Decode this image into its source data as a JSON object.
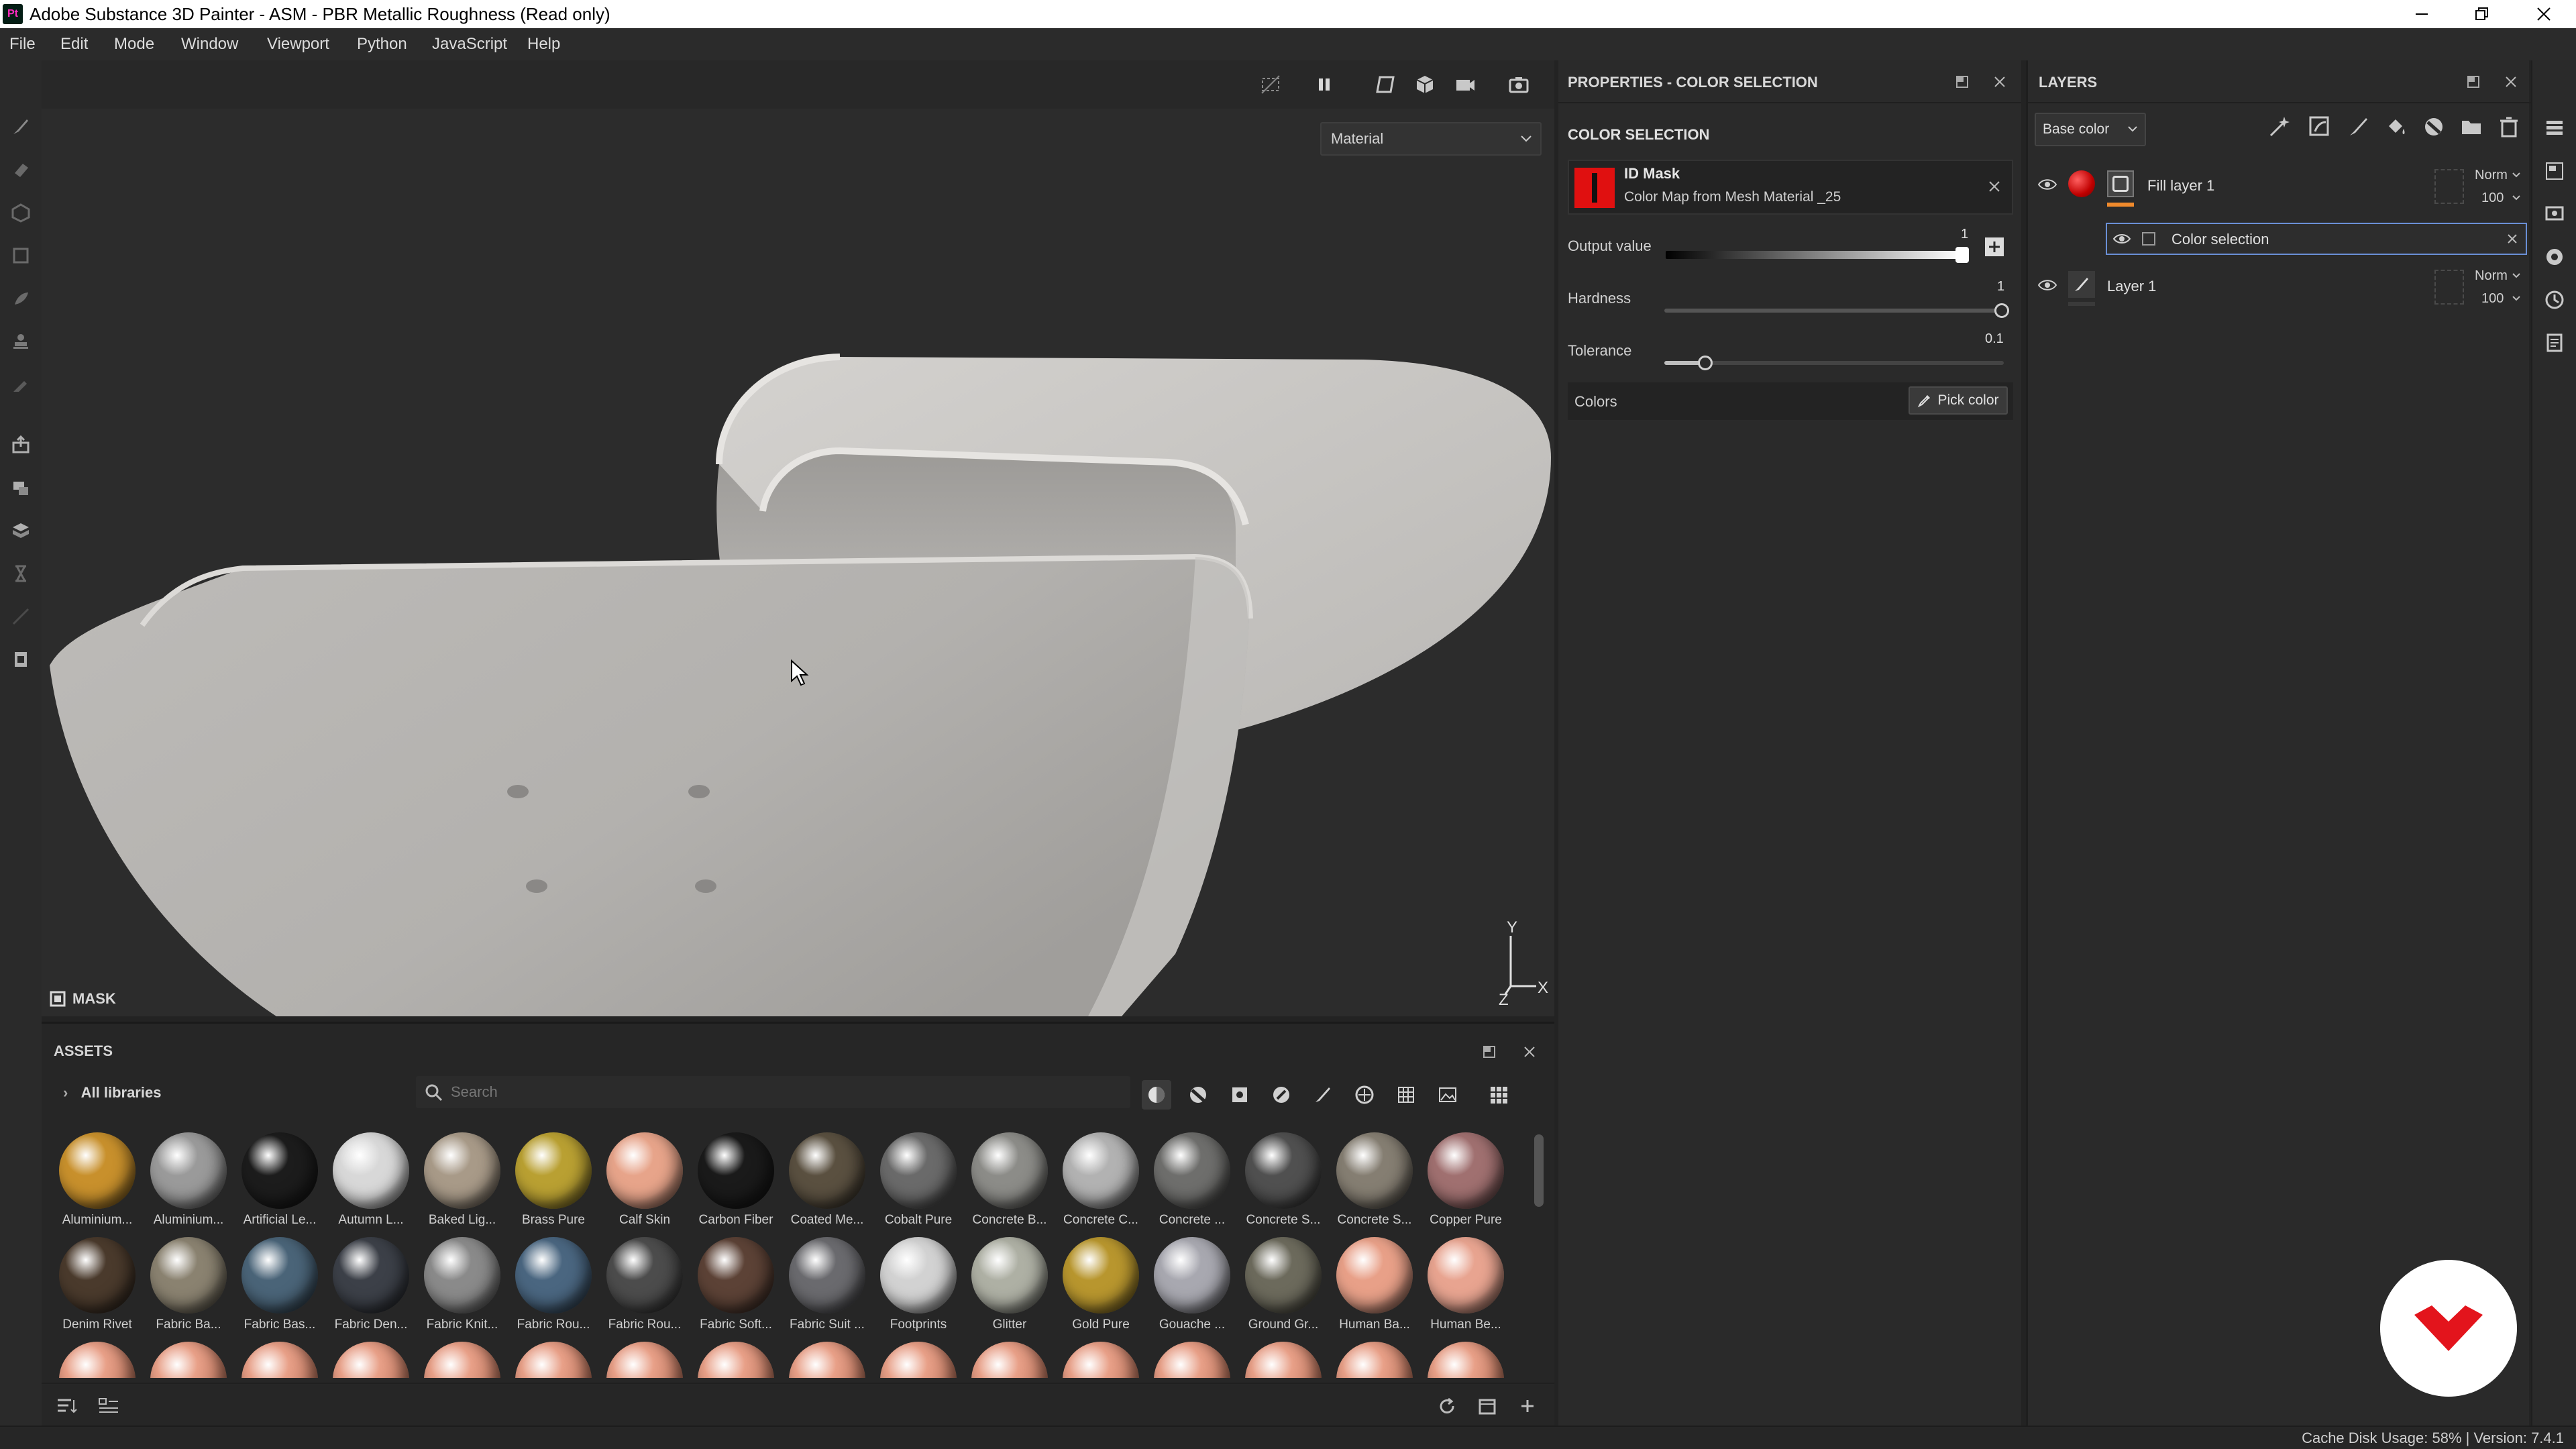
{
  "window": {
    "app_logo": "Pt",
    "title": "Adobe Substance 3D Painter - ASM - PBR Metallic Roughness (Read only)",
    "controls": [
      "minimize-icon",
      "restore-icon",
      "close-icon"
    ]
  },
  "menu": [
    "File",
    "Edit",
    "Mode",
    "Window",
    "Viewport",
    "Python",
    "JavaScript",
    "Help"
  ],
  "left_tools": [
    "paint-brush-icon",
    "eraser-icon",
    "projection-icon",
    "geometry-mask-icon",
    "smudge-icon",
    "clone-stamp-icon",
    "color-picker-icon",
    "bake-icon",
    "texture-set-icon",
    "uv-icon",
    "history-icon",
    "symmetry-icon",
    "export-icon"
  ],
  "viewport": {
    "mode_select": "Material",
    "mask_label": "MASK",
    "gizmo": {
      "y": "Y",
      "x": "X",
      "z": "Z"
    }
  },
  "assets": {
    "title": "ASSETS",
    "libraries_label": "All libraries",
    "search_placeholder": "Search",
    "items": [
      {
        "label": "Aluminium...",
        "color": "#c8902c"
      },
      {
        "label": "Aluminium...",
        "color": "#9a9a9a"
      },
      {
        "label": "Artificial Le...",
        "color": "#1c1c1c"
      },
      {
        "label": "Autumn L...",
        "color": "#d8d8d8"
      },
      {
        "label": "Baked Lig...",
        "color": "#a89a88"
      },
      {
        "label": "Brass Pure",
        "color": "#b9a032"
      },
      {
        "label": "Calf Skin",
        "color": "#e7a48a"
      },
      {
        "label": "Carbon Fiber",
        "color": "#1a1a1a"
      },
      {
        "label": "Coated Me...",
        "color": "#5a5040"
      },
      {
        "label": "Cobalt Pure",
        "color": "#6a6a6a"
      },
      {
        "label": "Concrete B...",
        "color": "#8c8c88"
      },
      {
        "label": "Concrete C...",
        "color": "#b2b2b2"
      },
      {
        "label": "Concrete ...",
        "color": "#6e6e6c"
      },
      {
        "label": "Concrete S...",
        "color": "#505050"
      },
      {
        "label": "Concrete S...",
        "color": "#857e72"
      },
      {
        "label": "Copper Pure",
        "color": "#a07070"
      },
      {
        "label": "Denim Rivet",
        "color": "#4a3a2c"
      },
      {
        "label": "Fabric Ba...",
        "color": "#8a8270"
      },
      {
        "label": "Fabric Bas...",
        "color": "#4a6478"
      },
      {
        "label": "Fabric Den...",
        "color": "#3c4048"
      },
      {
        "label": "Fabric Knit...",
        "color": "#8a8a8a"
      },
      {
        "label": "Fabric Rou...",
        "color": "#4a6680"
      },
      {
        "label": "Fabric Rou...",
        "color": "#4c4c4c"
      },
      {
        "label": "Fabric Soft...",
        "color": "#5c4236"
      },
      {
        "label": "Fabric Suit ...",
        "color": "#6a6a6e"
      },
      {
        "label": "Footprints",
        "color": "#d2d2d2"
      },
      {
        "label": "Glitter",
        "color": "#aeb0a4"
      },
      {
        "label": "Gold Pure",
        "color": "#b8962e"
      },
      {
        "label": "Gouache ...",
        "color": "#a8a8b0"
      },
      {
        "label": "Ground Gr...",
        "color": "#6c6a5c"
      },
      {
        "label": "Human Ba...",
        "color": "#e8a088"
      },
      {
        "label": "Human Be...",
        "color": "#e8a490"
      }
    ]
  },
  "properties": {
    "header": "PROPERTIES - COLOR SELECTION",
    "section": "COLOR SELECTION",
    "id_mask_title": "ID Mask",
    "id_mask_source": "Color Map from Mesh Material _25",
    "output_value_label": "Output value",
    "output_value": "1",
    "hardness_label": "Hardness",
    "hardness": "1",
    "tolerance_label": "Tolerance",
    "tolerance": "0.1",
    "colors_label": "Colors",
    "pick_color_label": "Pick color"
  },
  "layers": {
    "title": "LAYERS",
    "channel": "Base color",
    "items": [
      {
        "name": "Fill layer 1",
        "blend": "Norm",
        "opacity": "100"
      },
      {
        "name": "Color selection"
      },
      {
        "name": "Layer 1",
        "blend": "Norm",
        "opacity": "100"
      }
    ]
  },
  "status": {
    "text": "Cache Disk Usage:    58% | Version: 7.4.1"
  }
}
